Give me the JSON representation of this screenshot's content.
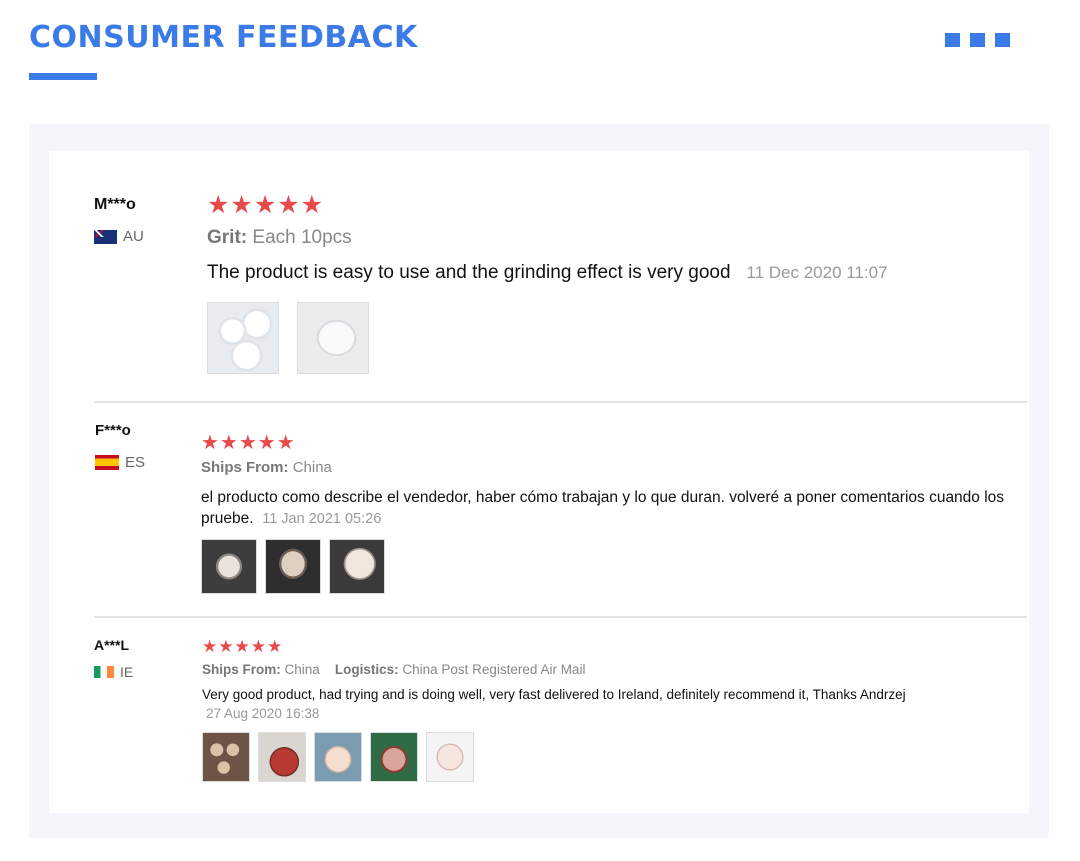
{
  "header": {
    "title": "CONSUMER FEEDBACK",
    "accent_color": "#3b7be8",
    "menu_icon": "three-squares-icon"
  },
  "reviews": [
    {
      "user": "M***o",
      "country_code": "AU",
      "flag_icon": "australia-flag-icon",
      "rating": 5,
      "stars": "★★★★★",
      "attribute_label": "Grit:",
      "attribute_value": "Each 10pcs",
      "text": "The product is easy to use and the grinding effect is very good",
      "date": "11 Dec 2020 11:07",
      "photos": [
        "sanding-discs-photo",
        "sanding-disc-stack-photo"
      ]
    },
    {
      "user": "F***o",
      "country_code": "ES",
      "flag_icon": "spain-flag-icon",
      "rating": 5,
      "stars": "★★★★★",
      "ships_label": "Ships From:",
      "ships_value": "China",
      "text": "el producto como describe el vendedor, haber cómo trabajan y lo que duran. volveré a poner comentarios cuando los pruebe.",
      "date": "11 Jan 2021 05:26",
      "photos": [
        "disc-pack-photo",
        "disc-pack-photo",
        "disc-photo"
      ]
    },
    {
      "user": "A***L",
      "country_code": "IE",
      "flag_icon": "ireland-flag-icon",
      "rating": 5,
      "stars": "★★★★★",
      "ships_label": "Ships From:",
      "ships_value": "China",
      "logistics_label": "Logistics:",
      "logistics_value": "China Post Registered Air Mail",
      "text": "Very good product, had trying and is doing well, very fast delivered to Ireland, definitely recommend it, Thanks Andrzej",
      "date": "27 Aug 2020 16:38",
      "photos": [
        "discs-on-wood-photo",
        "red-disc-photo",
        "disc-in-hand-photo",
        "sander-photo",
        "disc-closeup-photo"
      ]
    }
  ]
}
